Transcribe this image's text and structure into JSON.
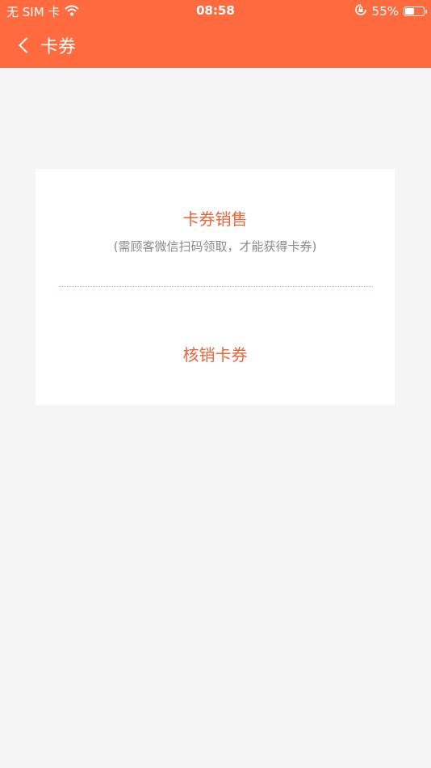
{
  "status_bar": {
    "carrier": "无 SIM 卡",
    "time": "08:58",
    "battery": "55%",
    "battery_level": 0.55
  },
  "nav": {
    "title": "卡券"
  },
  "ticket": {
    "sale_title": "卡券销售",
    "sale_subtitle": "(需顾客微信扫码领取，才能获得卡券)",
    "verify_title": "核销卡券"
  },
  "colors": {
    "accent": "#ff6b3f",
    "text_accent": "#e8653a",
    "background": "#f5f5f5"
  }
}
